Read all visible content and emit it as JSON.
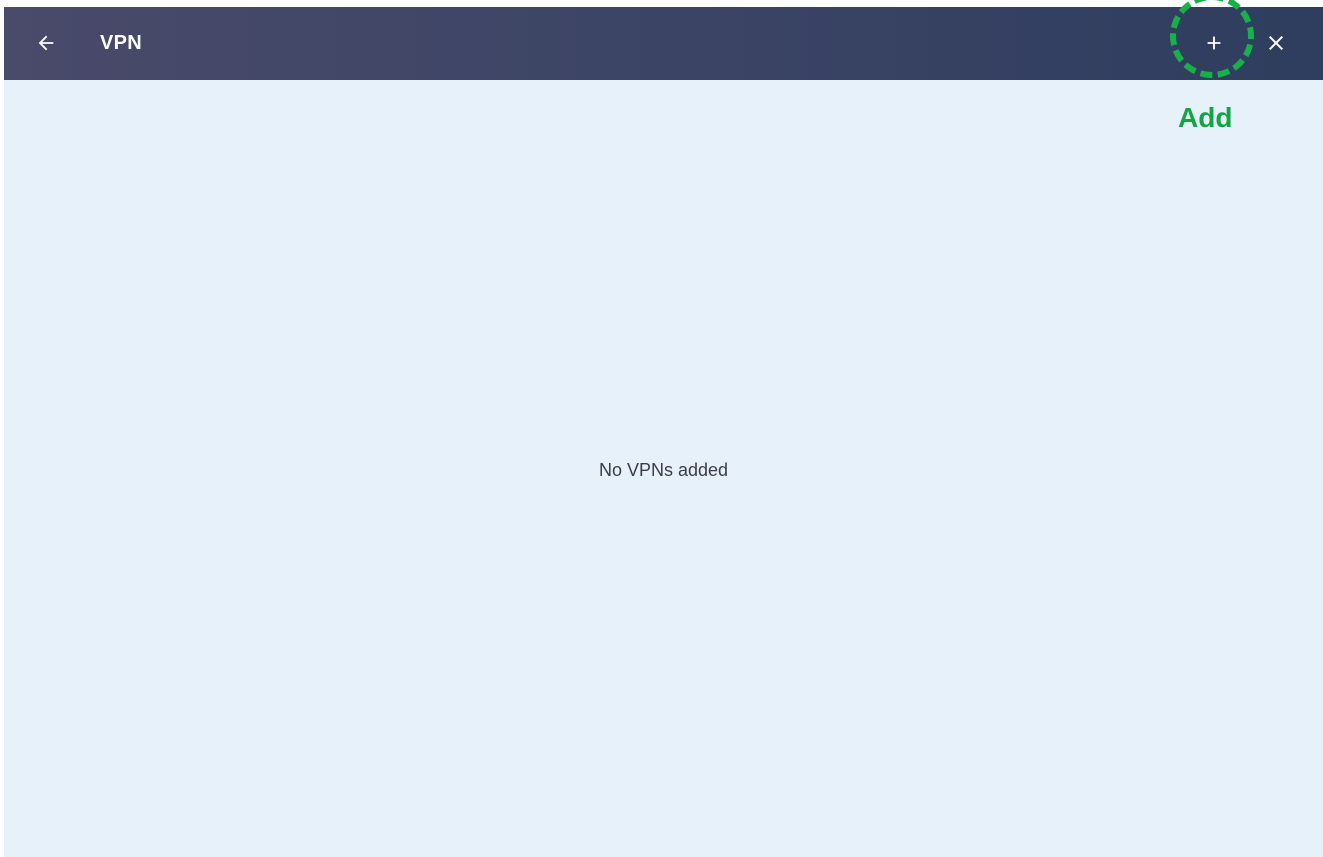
{
  "header": {
    "title": "VPN",
    "back_icon": "arrow-left-icon",
    "add_icon": "plus-icon",
    "close_icon": "close-icon"
  },
  "main": {
    "empty_message": "No VPNs added"
  },
  "annotation": {
    "label": "Add",
    "color": "#16b14a"
  },
  "colors": {
    "header_gradient_start": "#4a4a6a",
    "header_gradient_end": "#2f3d5e",
    "content_background": "#e7f1fa"
  }
}
